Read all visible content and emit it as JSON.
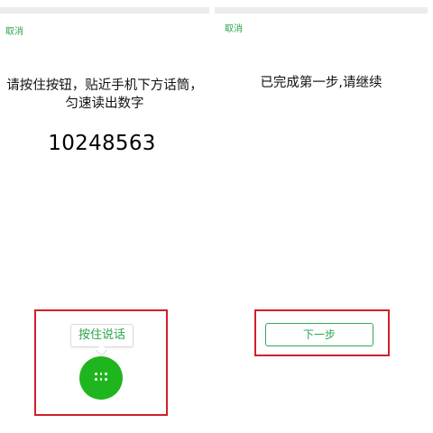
{
  "left_screen": {
    "cancel_label": "取消",
    "instruction": "请按住按钮，贴近手机下方话筒，匀速读出数字",
    "digits": "10248563",
    "tooltip_label": "按住说话",
    "button_icon": "dots-grid-icon"
  },
  "right_screen": {
    "cancel_label": "取消",
    "done_text": "已完成第一步,请继续",
    "next_label": "下一步"
  },
  "colors": {
    "accent_green": "#2aa64b",
    "button_green": "#1fb51e",
    "highlight_red": "#d0202a"
  }
}
